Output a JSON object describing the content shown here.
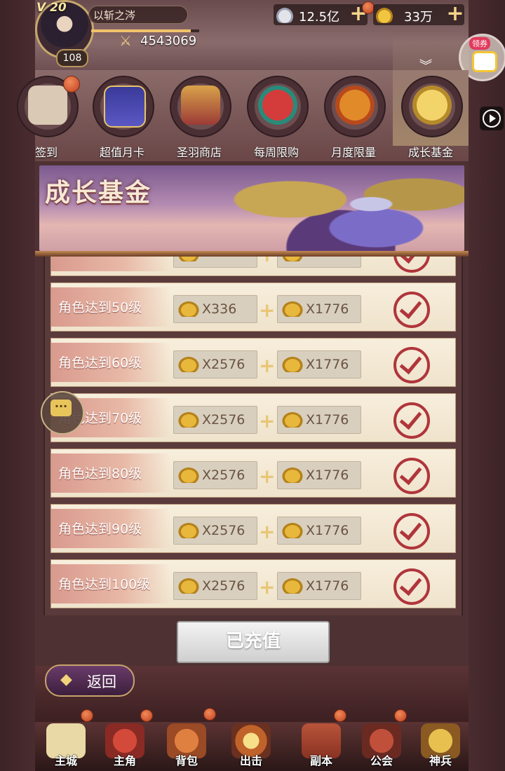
{
  "player": {
    "vip": "V 20",
    "name": "以斩之涔",
    "level": "108",
    "power": "4543069",
    "xp_fraction": 0.92
  },
  "resources": {
    "silver": "12.5亿",
    "gold": "33万"
  },
  "coupon_label": "领券",
  "tabs": [
    {
      "label": "签到"
    },
    {
      "label": "超值月卡"
    },
    {
      "label": "圣羽商店"
    },
    {
      "label": "每周限购"
    },
    {
      "label": "月度限量"
    },
    {
      "label": "成长基金"
    }
  ],
  "banner_title": "成长基金",
  "rows": [
    {
      "condition": "角色达到50级",
      "reward1": "X336",
      "reward2": "X1776"
    },
    {
      "condition": "角色达到60级",
      "reward1": "X2576",
      "reward2": "X1776"
    },
    {
      "condition": "角色达到70级",
      "reward1": "X2576",
      "reward2": "X1776"
    },
    {
      "condition": "角色达到80级",
      "reward1": "X2576",
      "reward2": "X1776"
    },
    {
      "condition": "角色达到90级",
      "reward1": "X2576",
      "reward2": "X1776"
    },
    {
      "condition": "角色达到100级",
      "reward1": "X2576",
      "reward2": "X1776"
    }
  ],
  "recharge_button": "已充值",
  "back_button": "返回",
  "nav": [
    {
      "label": "主城"
    },
    {
      "label": "主角"
    },
    {
      "label": "背包"
    },
    {
      "label": "出击"
    },
    {
      "label": "副本"
    },
    {
      "label": "公会"
    },
    {
      "label": "神兵"
    }
  ],
  "colors": {
    "gold_accent": "#f5d48a",
    "check_red": "#b0353b",
    "row_bg": "#f7eedc"
  }
}
